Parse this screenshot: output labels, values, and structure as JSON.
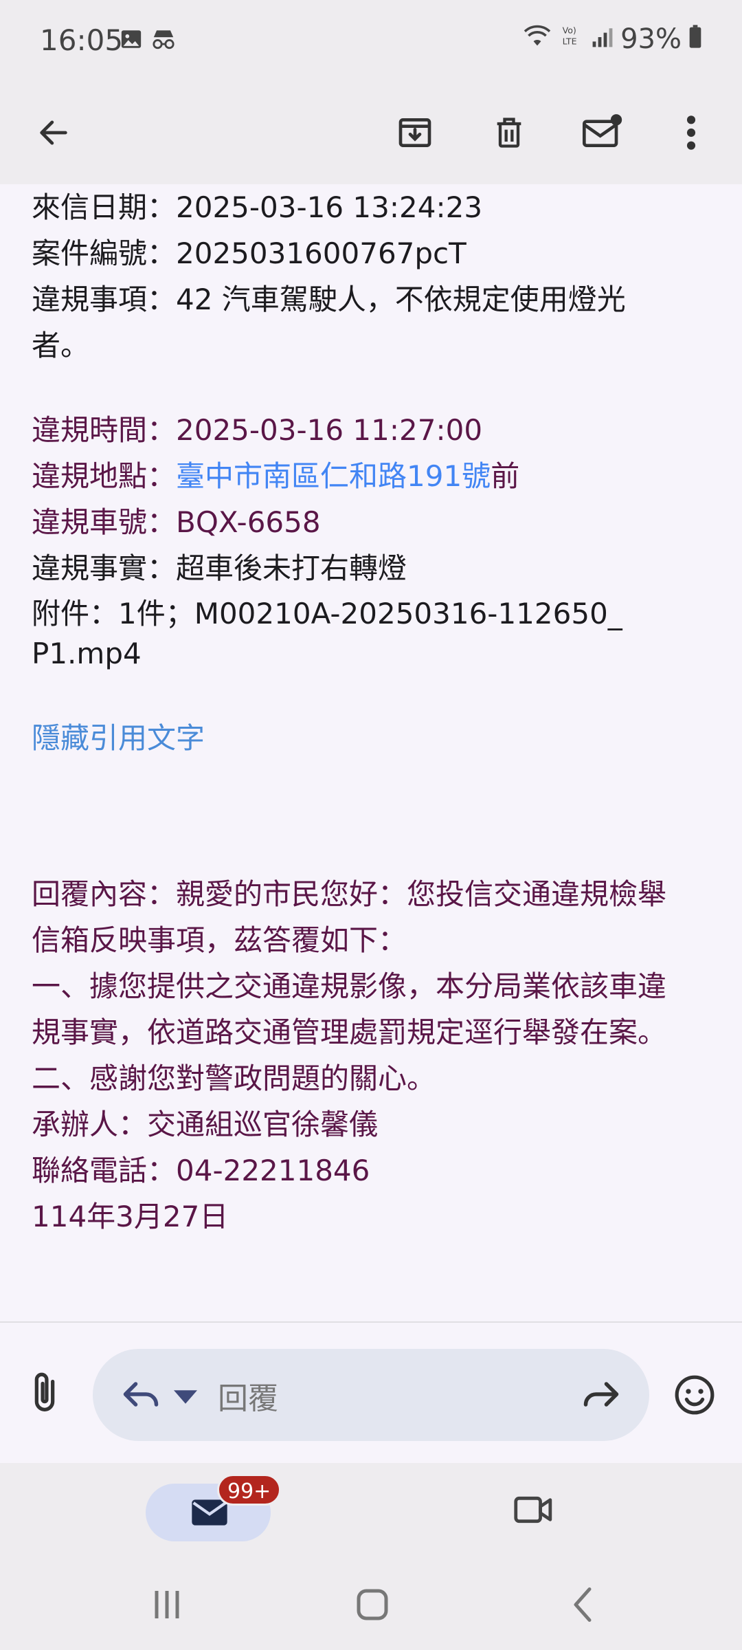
{
  "status_bar": {
    "time": "16:05",
    "battery": "93%",
    "icons": [
      "image-icon",
      "incognito-icon",
      "wifi-icon",
      "volte-icon",
      "signal-icon",
      "battery-icon"
    ]
  },
  "app_bar": {
    "icons": [
      "back-arrow-icon",
      "archive-icon",
      "delete-icon",
      "mark-unread-icon",
      "more-vert-icon"
    ]
  },
  "email": {
    "date_line": "來信日期：2025-03-16 13:24:23",
    "case_line": "案件編號：2025031600767pcT",
    "violation_item_line1": "違規事項：42 汽車駕駛人，不依規定使用燈光",
    "violation_item_line2": "者。",
    "violation_time_line": "違規時間：2025-03-16 11:27:00",
    "violation_location_prefix": "違規地點：",
    "violation_location_link": "臺中市南區仁和路191號",
    "violation_location_suffix": "前",
    "plate_line": "違規車號：BQX-6658",
    "facts_line": "違規事實：超車後未打右轉燈",
    "attachment_line1": "附件：1件；M00210A-20250316-112650_",
    "attachment_line2": "P1.mp4",
    "hide_quoted": "隱藏引用文字",
    "reply_lines": [
      "回覆內容：親愛的市民您好：您投信交通違規檢舉",
      "信箱反映事項，茲答覆如下：",
      "一、據您提供之交通違規影像，本分局業依該車違",
      "規事實，依道路交通管理處罰規定逕行舉發在案。",
      "二、感謝您對警政問題的關心。",
      "承辦人：交通組巡官徐馨儀",
      "聯絡電話：04-22211846",
      "114年3月27日"
    ]
  },
  "reply_bar": {
    "placeholder": "回覆"
  },
  "bottom_nav": {
    "mail_badge": "99+"
  },
  "colors": {
    "accent_purple": "#5a1647",
    "link_blue": "#4285f4",
    "badge_red": "#b3261e"
  }
}
